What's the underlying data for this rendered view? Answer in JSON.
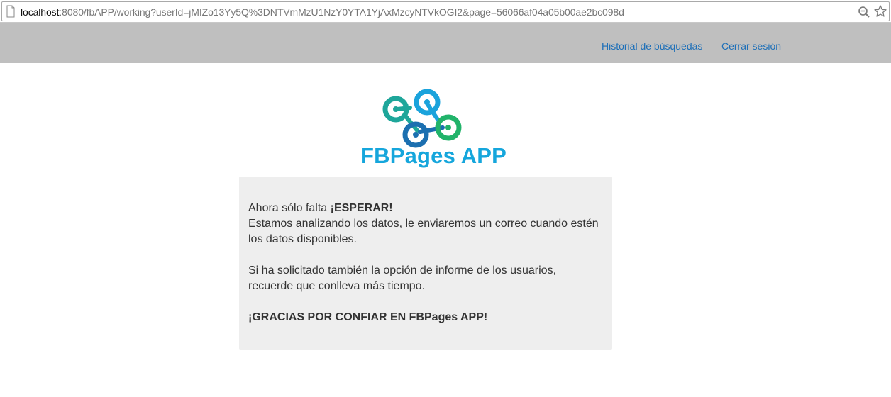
{
  "browser": {
    "url_host": "localhost",
    "url_rest": ":8080/fbAPP/working?userId=jMIZo13Yy5Q%3DNTVmMzU1NzY0YTA1YjAxMzcyNTVkOGI2&page=56066af04a05b00ae2bc098d"
  },
  "navbar": {
    "history_label": "Historial de búsquedas",
    "logout_label": "Cerrar sesión"
  },
  "logo": {
    "text": "FBPages APP"
  },
  "message": {
    "line1_prefix": "Ahora sólo falta ",
    "line1_bold": "¡ESPERAR!",
    "line2": "Estamos analizando los datos, le enviaremos un correo cuando estén los datos disponibles.",
    "paragraph2": "Si ha solicitado también la opción de informe de los usuarios, recuerde que conlleva más tiempo.",
    "thanks": "¡GRACIAS POR CONFIAR EN FBPages APP!"
  },
  "colors": {
    "navbar_bg": "#bfbfbf",
    "link": "#1d6fb8",
    "logo_text": "#15a6dc",
    "logo_teal": "#1ea69a",
    "logo_blue": "#1aa3dc",
    "logo_green": "#21b36a",
    "logo_darkblue": "#1b6fb0",
    "message_bg": "#eeeeee"
  }
}
